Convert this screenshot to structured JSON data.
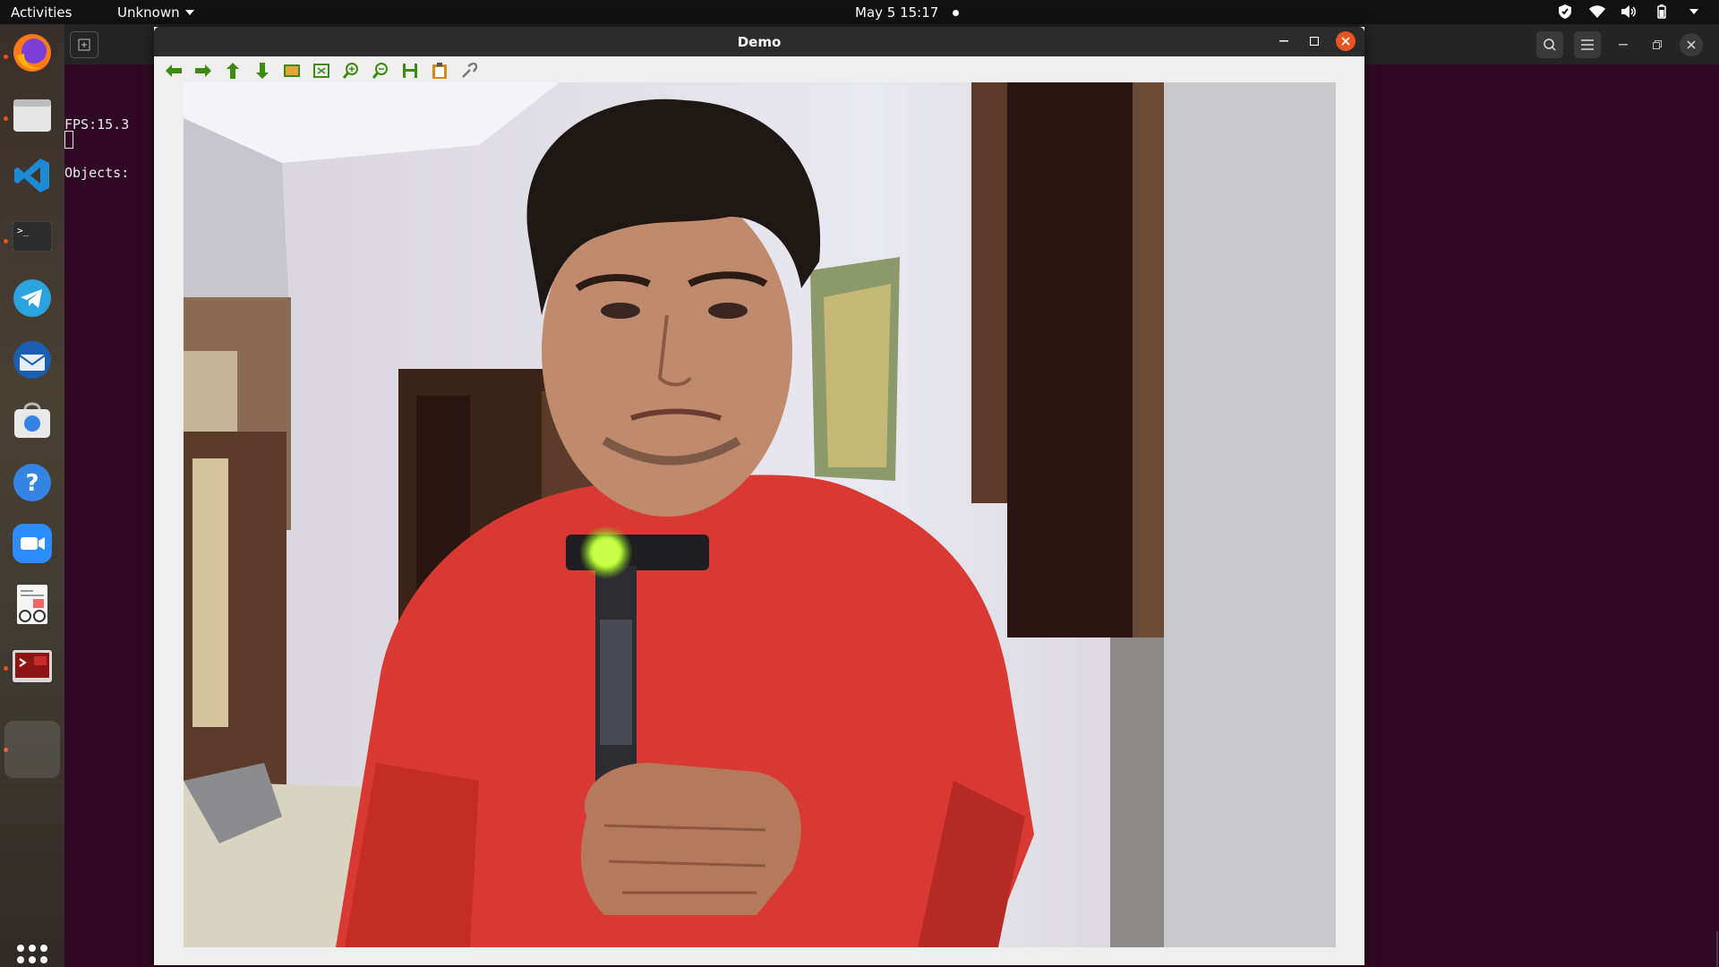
{
  "topbar": {
    "activities": "Activities",
    "app_menu": "Unknown",
    "clock": "May 5  15:17"
  },
  "dock": {
    "items": [
      {
        "name": "firefox-icon",
        "running": true
      },
      {
        "name": "files-icon",
        "running": true
      },
      {
        "name": "vscode-icon",
        "running": false
      },
      {
        "name": "terminal-icon",
        "running": true
      },
      {
        "name": "telegram-icon",
        "running": false
      },
      {
        "name": "thunderbird-icon",
        "running": false
      },
      {
        "name": "software-store-icon",
        "running": false
      },
      {
        "name": "help-icon",
        "running": false
      },
      {
        "name": "zoom-icon",
        "running": false
      },
      {
        "name": "document-viewer-icon",
        "running": false
      },
      {
        "name": "remote-desktop-icon",
        "running": true
      },
      {
        "name": "demo-window-icon",
        "running": true
      }
    ]
  },
  "terminal": {
    "line1": "FPS:15.3",
    "line2": "Objects:"
  },
  "demo_window": {
    "title": "Demo",
    "toolbar": [
      "pan-left-icon",
      "pan-right-icon",
      "pan-up-icon",
      "pan-down-icon",
      "zoom-image-icon",
      "zoom-fit-icon",
      "zoom-in-icon",
      "zoom-out-icon",
      "save-icon",
      "copy-icon",
      "properties-icon"
    ]
  },
  "colors": {
    "accent": "#e95420",
    "terminal_bg": "#300a24",
    "toolbar_icon": "#3c8a10",
    "shirt": "#d83a33",
    "light": "#b6f536"
  }
}
